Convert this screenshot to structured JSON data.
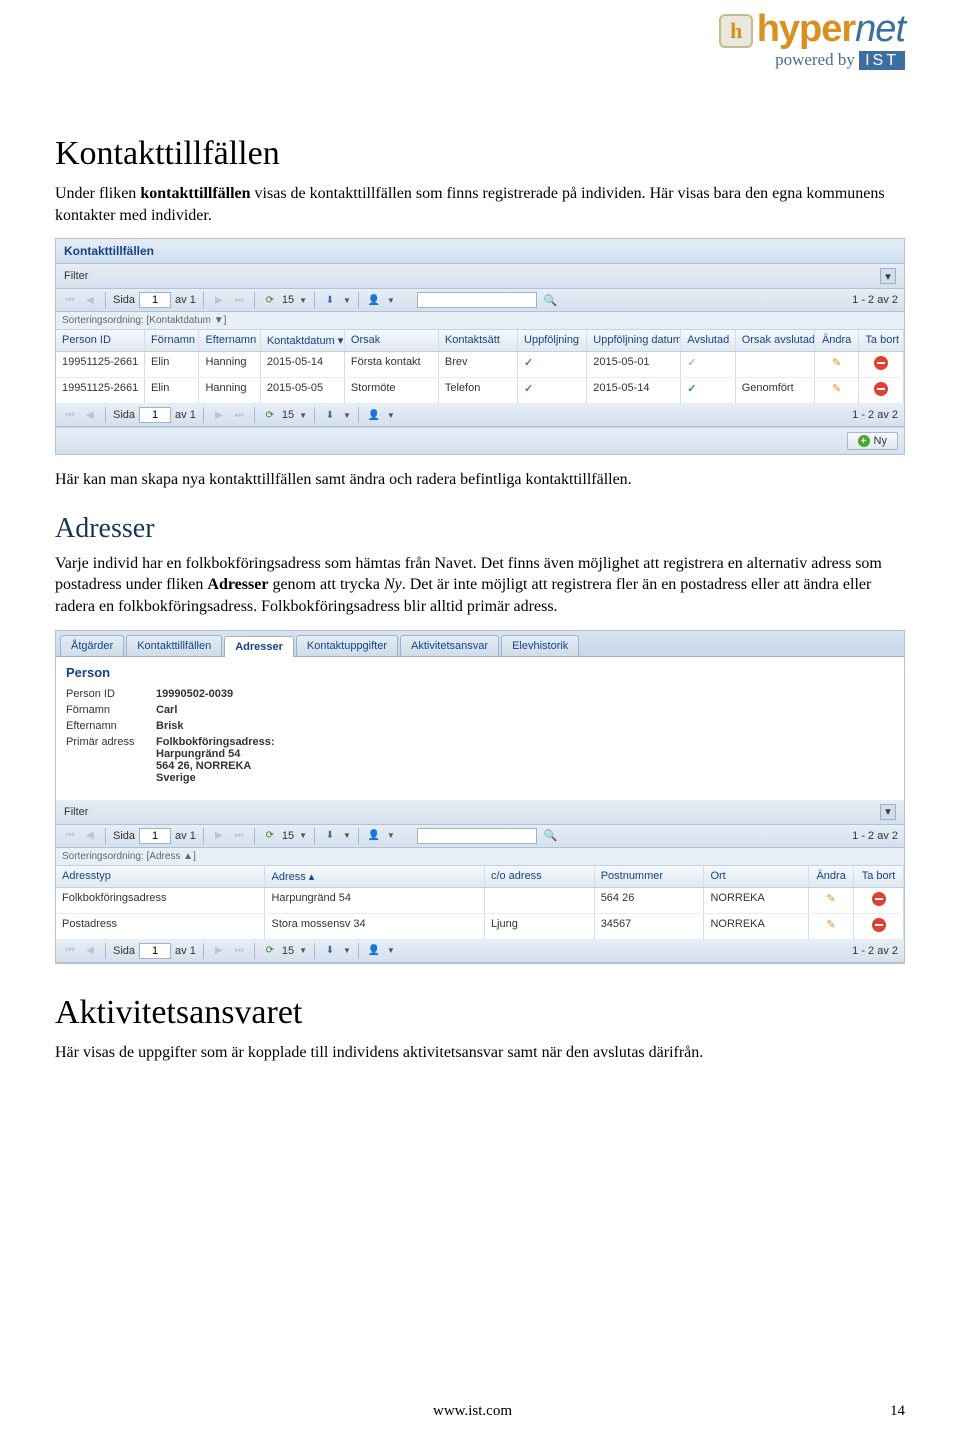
{
  "logo": {
    "brand_h": "hyper",
    "brand_n": "net",
    "powered": "powered by",
    "ist": "IST",
    "badge": "h"
  },
  "h1_kontakt": "Kontakttillfällen",
  "p1a": "Under fliken ",
  "p1b": "kontakttillfällen",
  "p1c": " visas de kontakttillfällen som finns registrerade på individen. Här visas bara den egna kommunens kontakter med individer.",
  "k_panel": {
    "title": "Kontakttillfällen",
    "filter": "Filter",
    "page_label": "Sida",
    "page": "1",
    "of": "av 1",
    "pgs": "15",
    "count": "1 - 2 av 2",
    "sort": "Sorteringsordning: [",
    "sort_field": "Kontaktdatum",
    "sort_close": " ▼]",
    "head": [
      "Person ID",
      "Förnamn",
      "Efternamn",
      "Kontaktdatum ▾",
      "Orsak",
      "Kontaktsätt",
      "Uppföljning",
      "Uppföljning datum",
      "Avslutad",
      "Orsak avslutad",
      "Ändra",
      "Ta bort"
    ],
    "rows": [
      {
        "pid": "19951125-2661",
        "fn": "Elin",
        "en": "Hanning",
        "kd": "2015-05-14",
        "or": "Första kontakt",
        "ks": "Brev",
        "uf": "✓",
        "ud": "2015-05-01",
        "av": "gray",
        "oa": ""
      },
      {
        "pid": "19951125-2661",
        "fn": "Elin",
        "en": "Hanning",
        "kd": "2015-05-05",
        "or": "Stormöte",
        "ks": "Telefon",
        "uf": "✓",
        "ud": "2015-05-14",
        "av": "✓",
        "oa": "Genomfört"
      }
    ],
    "ny": "Ny"
  },
  "p2": "Här kan man skapa nya kontakttillfällen samt ändra och radera befintliga kontakttillfällen.",
  "h2_adresser": "Adresser",
  "p3a": "Varje individ har en folkbokföringsadress som hämtas från Navet. Det finns även möjlighet att registrera en alternativ adress som postadress under fliken ",
  "p3b": "Adresser",
  "p3c": " genom att trycka ",
  "p3d": "Ny",
  "p3e": ". Det är inte möjligt att registrera fler än en postadress eller att ändra eller radera en folkbokföringsadress. Folkbokföringsadress blir alltid primär adress.",
  "a_panel": {
    "tabs": [
      "Åtgärder",
      "Kontakttillfällen",
      "Adresser",
      "Kontaktuppgifter",
      "Aktivitetsansvar",
      "Elevhistorik"
    ],
    "active_tab": 2,
    "person_title": "Person",
    "fields": {
      "pid_l": "Person ID",
      "pid": "19990502-0039",
      "fn_l": "Förnamn",
      "fn": "Carl",
      "en_l": "Efternamn",
      "en": "Brisk",
      "pa_l": "Primär adress",
      "pa1": "Folkbokföringsadress:",
      "pa2": "Harpungränd 54",
      "pa3": "564 26, NORREKA",
      "pa4": "Sverige"
    },
    "filter": "Filter",
    "page_label": "Sida",
    "page": "1",
    "of": "av 1",
    "pgs": "15",
    "count": "1 - 2 av 2",
    "sort": "Sorteringsordning: [",
    "sort_field": "Adress",
    "sort_close": " ▲]",
    "head": [
      "Adresstyp",
      "Adress ▴",
      "c/o adress",
      "Postnummer",
      "Ort",
      "Ändra",
      "Ta bort"
    ],
    "rows": [
      {
        "typ": "Folkbokföringsadress",
        "adr": "Harpungränd 54",
        "co": "",
        "pn": "564 26",
        "ort": "NORREKA"
      },
      {
        "typ": "Postadress",
        "adr": "Stora mossensv 34",
        "co": "Ljung",
        "pn": "34567",
        "ort": "NORREKA"
      }
    ]
  },
  "h1_aktiv": "Aktivitetsansvaret",
  "p4": "Här visas de uppgifter som är kopplade till individens aktivitetsansvar samt när den avslutas därifrån.",
  "footer_url": "www.ist.com",
  "footer_page": "14"
}
